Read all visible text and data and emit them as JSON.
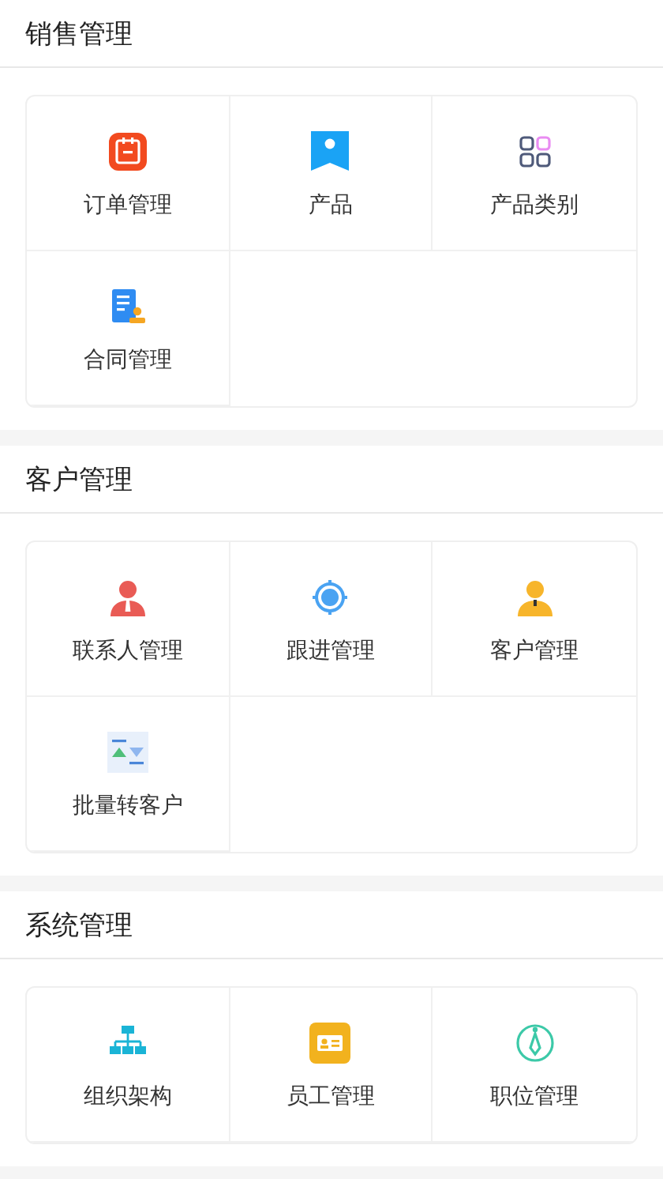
{
  "sections": [
    {
      "title": "销售管理",
      "items": [
        {
          "label": "订单管理",
          "kind": "calendar"
        },
        {
          "label": "产品",
          "kind": "bookmark"
        },
        {
          "label": "产品类别",
          "kind": "grid"
        },
        {
          "label": "合同管理",
          "kind": "contract"
        }
      ]
    },
    {
      "title": "客户管理",
      "items": [
        {
          "label": "联系人管理",
          "kind": "person-red"
        },
        {
          "label": "跟进管理",
          "kind": "target"
        },
        {
          "label": "客户管理",
          "kind": "person-yellow"
        },
        {
          "label": "批量转客户",
          "kind": "transfer"
        }
      ]
    },
    {
      "title": "系统管理",
      "items": [
        {
          "label": "组织架构",
          "kind": "org"
        },
        {
          "label": "员工管理",
          "kind": "card"
        },
        {
          "label": "职位管理",
          "kind": "tie"
        }
      ]
    }
  ]
}
